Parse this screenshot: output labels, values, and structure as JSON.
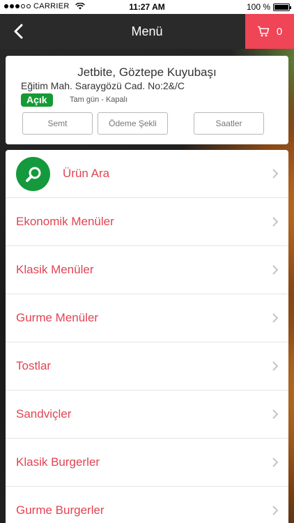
{
  "status_bar": {
    "carrier": "CARRIER",
    "time": "11:27 AM",
    "battery_text": "100 %",
    "battery_level": 1.0
  },
  "navbar": {
    "title": "Menü",
    "back_icon": "chevron-left-icon",
    "cart_icon": "cart-icon",
    "cart_count": "0",
    "cart_color": "#ef4556"
  },
  "store": {
    "name": "Jetbite, Göztepe Kuyubaşı",
    "address": "Eğitim Mah. Saraygözü Cad. No:2&/C",
    "status": "Açık",
    "status_color": "#159a34",
    "hours": "Tam gün - Kapalı",
    "buttons": {
      "semt": "Semt",
      "odeme": "Ödeme Şekli",
      "saatler": "Saatler"
    }
  },
  "menu": {
    "search_label": "Ürün Ara",
    "search_icon": "search-icon",
    "accent_color": "#e14452",
    "items": [
      "Ekonomik Menüler",
      "Klasik Menüler",
      "Gurme Menüler",
      "Tostlar",
      "Sandviçler",
      "Klasik Burgerler",
      "Gurme Burgerler"
    ]
  }
}
